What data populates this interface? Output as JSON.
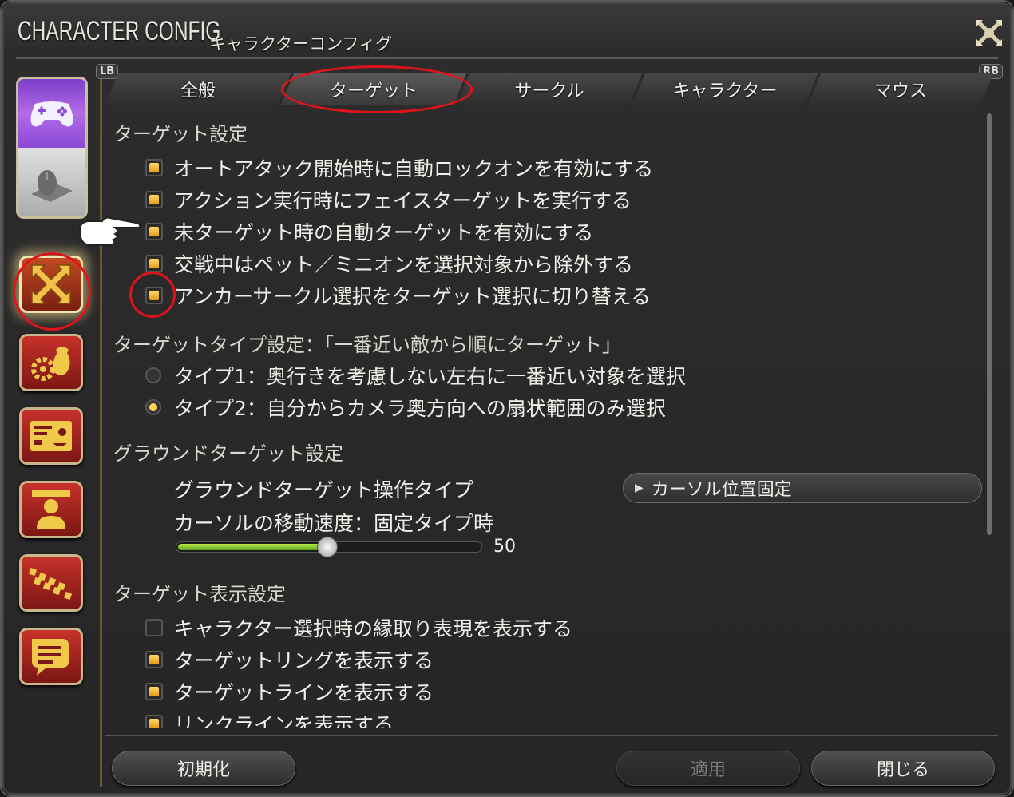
{
  "window": {
    "title_en": "CHARACTER CONFIG",
    "title_ja": "キャラクターコンフィグ",
    "lb_label": "LB",
    "rb_label": "RB"
  },
  "tabs": [
    {
      "label": "全般",
      "active": false
    },
    {
      "label": "ターゲット",
      "active": true
    },
    {
      "label": "サークル",
      "active": false
    },
    {
      "label": "キャラクター",
      "active": false
    },
    {
      "label": "マウス",
      "active": false
    }
  ],
  "sections": {
    "target_settings": {
      "heading": "ターゲット設定",
      "items": [
        {
          "label": "オートアタック開始時に自動ロックオンを有効にする",
          "checked": true
        },
        {
          "label": "アクション実行時にフェイスターゲットを実行する",
          "checked": true
        },
        {
          "label": "未ターゲット時の自動ターゲットを有効にする",
          "checked": true
        },
        {
          "label": "交戦中はペット／ミニオンを選択対象から除外する",
          "checked": true
        },
        {
          "label": "アンカーサークル選択をターゲット選択に切り替える",
          "checked": true
        }
      ]
    },
    "target_type": {
      "heading": "ターゲットタイプ設定：「一番近い敵から順にターゲット」",
      "options": [
        {
          "label": "タイプ1：奥行きを考慮しない左右に一番近い対象を選択",
          "selected": false
        },
        {
          "label": "タイプ2：自分からカメラ奥方向への扇状範囲のみ選択",
          "selected": true
        }
      ]
    },
    "ground_target": {
      "heading": "グラウンドターゲット設定",
      "operation_label": "グラウンドターゲット操作タイプ",
      "operation_value": "カーソル位置固定",
      "speed_label": "カーソルの移動速度：固定タイプ時",
      "speed_value": "50",
      "speed_fraction": 0.5
    },
    "target_display": {
      "heading": "ターゲット表示設定",
      "items": [
        {
          "label": "キャラクター選択時の縁取り表現を表示する",
          "checked": false
        },
        {
          "label": "ターゲットリングを表示する",
          "checked": true
        },
        {
          "label": "ターゲットラインを表示する",
          "checked": true
        },
        {
          "label": "リンクラインを表示する",
          "checked": true
        }
      ]
    }
  },
  "footer": {
    "reset": "初期化",
    "apply": "適用",
    "close": "閉じる"
  },
  "colors": {
    "checkbox_on": "#f0b030",
    "highlight_ring": "#e0131b",
    "slider_fill": "#8fd630"
  }
}
